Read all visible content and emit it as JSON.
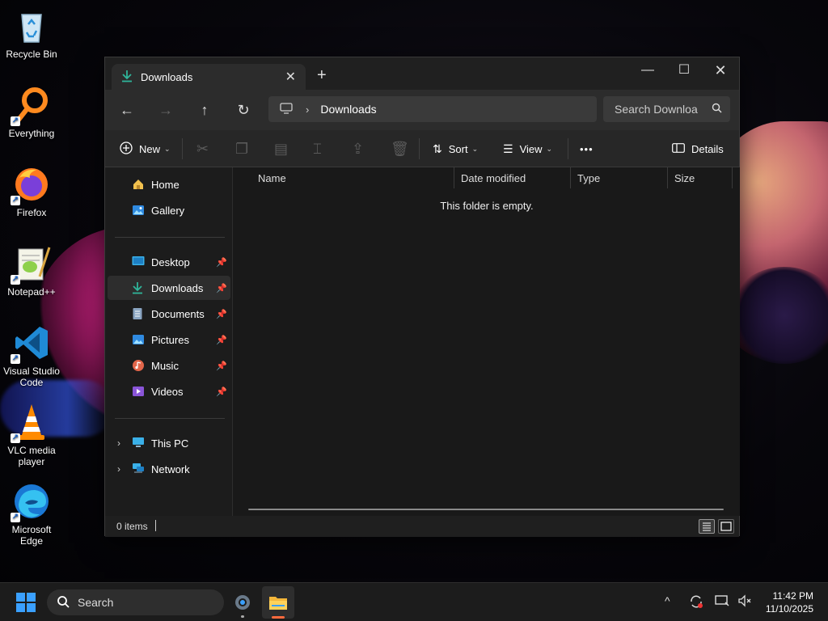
{
  "desktop": {
    "icons": [
      {
        "label": "Recycle Bin"
      },
      {
        "label": "Everything"
      },
      {
        "label": "Firefox"
      },
      {
        "label": "Notepad++"
      },
      {
        "label": "Visual Studio Code"
      },
      {
        "label": "VLC media player"
      },
      {
        "label": "Microsoft Edge"
      }
    ]
  },
  "window": {
    "tab_title": "Downloads",
    "address": {
      "location": "Downloads"
    },
    "search": {
      "placeholder": "Search Downloa"
    },
    "toolbar": {
      "new_label": "New",
      "sort_label": "Sort",
      "view_label": "View",
      "more_label": "•••",
      "details_label": "Details"
    },
    "sidebar": {
      "top": [
        {
          "label": "Home"
        },
        {
          "label": "Gallery"
        }
      ],
      "pinned": [
        {
          "label": "Desktop"
        },
        {
          "label": "Downloads"
        },
        {
          "label": "Documents"
        },
        {
          "label": "Pictures"
        },
        {
          "label": "Music"
        },
        {
          "label": "Videos"
        }
      ],
      "tree": [
        {
          "label": "This PC"
        },
        {
          "label": "Network"
        }
      ]
    },
    "columns": [
      "Name",
      "Date modified",
      "Type",
      "Size"
    ],
    "empty_message": "This folder is empty.",
    "status": {
      "item_count": "0 items"
    }
  },
  "taskbar": {
    "search_label": "Search",
    "clock": {
      "time": "11:42 PM",
      "date": "11/10/2025"
    }
  },
  "colors": {
    "accent": "#3aa0ff",
    "window_bg": "#191919",
    "downloads_icon": "#2fb59a"
  }
}
